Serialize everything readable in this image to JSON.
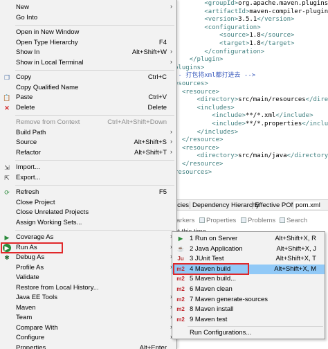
{
  "editor": {
    "lines": [
      {
        "indent": "        ",
        "open": "<groupId>",
        "text": "org.apache.maven.plugins",
        "close": "</g"
      },
      {
        "indent": "        ",
        "open": "<artifactId>",
        "text": "maven-compiler-plugin",
        "close": ""
      },
      {
        "indent": "        ",
        "open": "<version>",
        "text": "3.5.1",
        "close": "</version>"
      },
      {
        "indent": "        ",
        "open": "<configuration>",
        "text": "",
        "close": ""
      },
      {
        "indent": "            ",
        "open": "<source>",
        "text": "1.8",
        "close": "</source>"
      },
      {
        "indent": "            ",
        "open": "<target>",
        "text": "1.8",
        "close": "</target>"
      },
      {
        "indent": "        ",
        "open": "</configuration>",
        "text": "",
        "close": ""
      },
      {
        "indent": "    ",
        "open": "</plugin>",
        "text": "",
        "close": ""
      },
      {
        "indent": "",
        "open": "plugins>",
        "text": "",
        "close": ""
      },
      {
        "indent": "",
        "open": "",
        "text": "",
        "close": "",
        "comment": "-- 打包将xml都打进去 -->"
      },
      {
        "indent": "",
        "open": "esources>",
        "text": "",
        "close": ""
      },
      {
        "indent": "  ",
        "open": "<resource>",
        "text": "",
        "close": ""
      },
      {
        "indent": "      ",
        "open": "<directory>",
        "text": "src/main/resources",
        "close": "</direc"
      },
      {
        "indent": "      ",
        "open": "<includes>",
        "text": "",
        "close": ""
      },
      {
        "indent": "          ",
        "open": "<include>",
        "text": "**/*.xml",
        "close": "</include>"
      },
      {
        "indent": "          ",
        "open": "<include>",
        "text": "**/*.properties",
        "close": "</include>"
      },
      {
        "indent": "      ",
        "open": "</includes>",
        "text": "",
        "close": ""
      },
      {
        "indent": "  ",
        "open": "</resource>",
        "text": "",
        "close": ""
      },
      {
        "indent": "  ",
        "open": "<resource>",
        "text": "",
        "close": ""
      },
      {
        "indent": "      ",
        "open": "<directory>",
        "text": "src/main/java",
        "close": "</directory>"
      },
      {
        "indent": "  ",
        "open": "</resource>",
        "text": "",
        "close": ""
      },
      {
        "indent": "",
        "open": "resources>",
        "text": "",
        "close": ""
      }
    ],
    "top_fragment": "X E"
  },
  "bottom_tabs": {
    "t1": "icies",
    "t2": "Dependency Hierarchy",
    "t3": "Effective POM",
    "t4": "pom.xml"
  },
  "views": {
    "v1": "arkers",
    "v2": "Properties",
    "v3": "Problems",
    "v4": "Search"
  },
  "console_text": "at this time.",
  "menu": {
    "items": [
      {
        "label": "New",
        "shortcut": "",
        "submenu": true,
        "icon": "blank"
      },
      {
        "label": "Go Into",
        "shortcut": "",
        "submenu": false,
        "icon": "blank"
      },
      {
        "label": "Open in New Window",
        "shortcut": "",
        "submenu": false,
        "icon": "blank"
      },
      {
        "label": "Open Type Hierarchy",
        "shortcut": "F4",
        "submenu": false,
        "icon": "blank"
      },
      {
        "label": "Show In",
        "shortcut": "Alt+Shift+W",
        "submenu": true,
        "icon": "blank"
      },
      {
        "label": "Show in Local Terminal",
        "shortcut": "",
        "submenu": true,
        "icon": "blank"
      },
      {
        "label": "Copy",
        "shortcut": "Ctrl+C",
        "submenu": false,
        "icon": "copy"
      },
      {
        "label": "Copy Qualified Name",
        "shortcut": "",
        "submenu": false,
        "icon": "blank"
      },
      {
        "label": "Paste",
        "shortcut": "Ctrl+V",
        "submenu": false,
        "icon": "paste"
      },
      {
        "label": "Delete",
        "shortcut": "Delete",
        "submenu": false,
        "icon": "delete"
      },
      {
        "label": "Remove from Context",
        "shortcut": "Ctrl+Alt+Shift+Down",
        "submenu": false,
        "icon": "blank",
        "disabled": true
      },
      {
        "label": "Build Path",
        "shortcut": "",
        "submenu": true,
        "icon": "blank"
      },
      {
        "label": "Source",
        "shortcut": "Alt+Shift+S",
        "submenu": true,
        "icon": "blank"
      },
      {
        "label": "Refactor",
        "shortcut": "Alt+Shift+T",
        "submenu": true,
        "icon": "blank"
      },
      {
        "label": "Import...",
        "shortcut": "",
        "submenu": false,
        "icon": "import"
      },
      {
        "label": "Export...",
        "shortcut": "",
        "submenu": false,
        "icon": "export"
      },
      {
        "label": "Refresh",
        "shortcut": "F5",
        "submenu": false,
        "icon": "refresh"
      },
      {
        "label": "Close Project",
        "shortcut": "",
        "submenu": false,
        "icon": "blank"
      },
      {
        "label": "Close Unrelated Projects",
        "shortcut": "",
        "submenu": false,
        "icon": "blank"
      },
      {
        "label": "Assign Working Sets...",
        "shortcut": "",
        "submenu": false,
        "icon": "blank"
      },
      {
        "label": "Coverage As",
        "shortcut": "",
        "submenu": true,
        "icon": "coverage"
      },
      {
        "label": "Run As",
        "shortcut": "",
        "submenu": true,
        "icon": "run"
      },
      {
        "label": "Debug As",
        "shortcut": "",
        "submenu": true,
        "icon": "debug"
      },
      {
        "label": "Profile As",
        "shortcut": "",
        "submenu": true,
        "icon": "blank"
      },
      {
        "label": "Validate",
        "shortcut": "",
        "submenu": false,
        "icon": "blank"
      },
      {
        "label": "Restore from Local History...",
        "shortcut": "",
        "submenu": false,
        "icon": "blank"
      },
      {
        "label": "Java EE Tools",
        "shortcut": "",
        "submenu": true,
        "icon": "blank"
      },
      {
        "label": "Maven",
        "shortcut": "",
        "submenu": true,
        "icon": "blank"
      },
      {
        "label": "Team",
        "shortcut": "",
        "submenu": true,
        "icon": "blank"
      },
      {
        "label": "Compare With",
        "shortcut": "",
        "submenu": true,
        "icon": "blank"
      },
      {
        "label": "Configure",
        "shortcut": "",
        "submenu": true,
        "icon": "blank"
      },
      {
        "label": "Properties",
        "shortcut": "Alt+Enter",
        "submenu": false,
        "icon": "blank"
      }
    ]
  },
  "submenu": {
    "items": [
      {
        "label": "1 Run on Server",
        "shortcut": "Alt+Shift+X, R",
        "icon": "server"
      },
      {
        "label": "2 Java Application",
        "shortcut": "Alt+Shift+X, J",
        "icon": "java"
      },
      {
        "label": "3 JUnit Test",
        "shortcut": "Alt+Shift+X, T",
        "icon": "junit"
      },
      {
        "label": "4 Maven build",
        "shortcut": "Alt+Shift+X, M",
        "icon": "m2",
        "active": true
      },
      {
        "label": "5 Maven build...",
        "shortcut": "",
        "icon": "m2"
      },
      {
        "label": "6 Maven clean",
        "shortcut": "",
        "icon": "m2"
      },
      {
        "label": "7 Maven generate-sources",
        "shortcut": "",
        "icon": "m2"
      },
      {
        "label": "8 Maven install",
        "shortcut": "",
        "icon": "m2"
      },
      {
        "label": "9 Maven test",
        "shortcut": "",
        "icon": "m2"
      },
      {
        "label": "Run Configurations...",
        "shortcut": "",
        "icon": "blank"
      }
    ]
  },
  "arrow_glyph": "›",
  "m2_label": "m2",
  "colors": {
    "highlight": "#91c9f7",
    "red_box": "#e0282a",
    "menu_bg": "#f2f2f2"
  }
}
